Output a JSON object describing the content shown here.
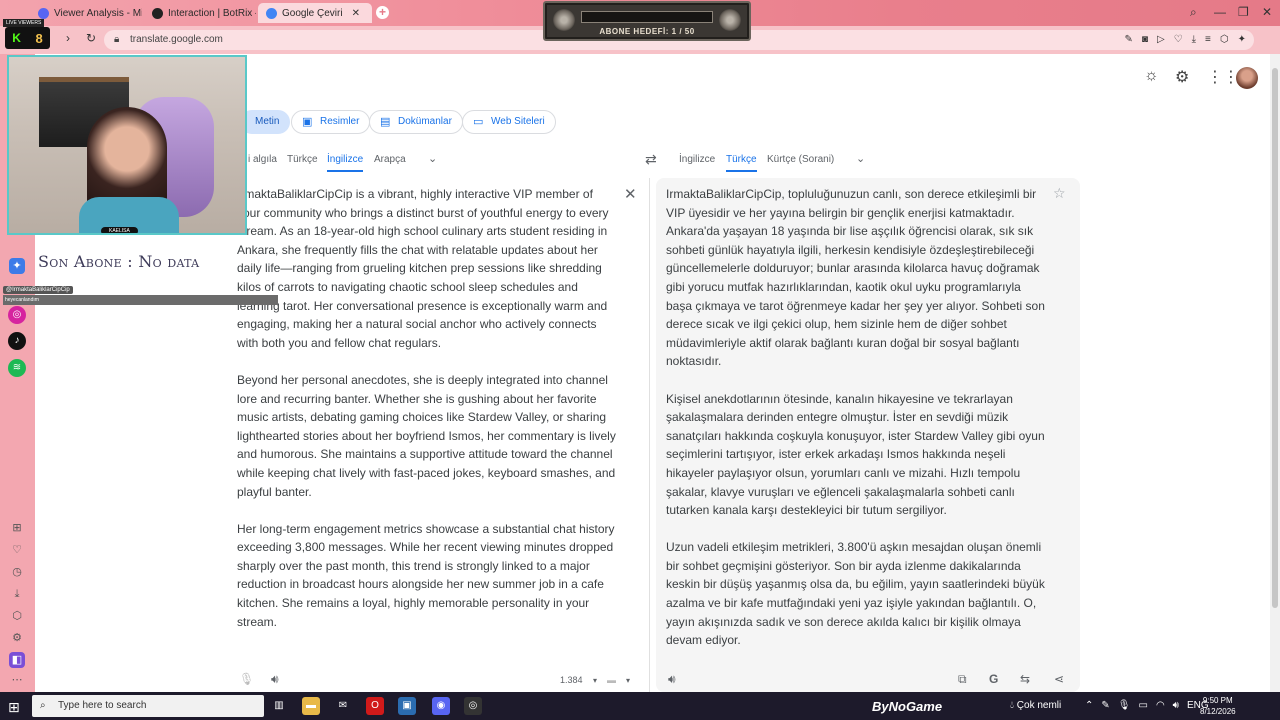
{
  "browser": {
    "tabs": [
      {
        "title": "Viewer Analysis - MissXs",
        "color": "#5865f2"
      },
      {
        "title": "Interaction | BotRix — Clo",
        "color": "#222222"
      },
      {
        "title": "Google Çeviri",
        "color": "#4285f4"
      }
    ],
    "url": "translate.google.com"
  },
  "overlay": {
    "live_viewers": "LIVE VIEWERS",
    "abone_hedefi": "ABONE HEDEFİ: 1 / 50",
    "son_abone": "Son Abone : No data",
    "cam_name": "KAELISA",
    "chat_user": "@IrmaktaBaliklarCipCip",
    "chat_msg": "heyecanlandım"
  },
  "translate": {
    "types": [
      "Metin",
      "Resimler",
      "Dokümanlar",
      "Web Siteleri"
    ],
    "source_langs": [
      "i algıla",
      "Türkçe",
      "İngilizce",
      "Arapça"
    ],
    "target_langs": [
      "İngilizce",
      "Türkçe",
      "Kürtçe (Sorani)"
    ],
    "source_paragraphs": [
      "IrmaktaBaliklarCipCip is a vibrant, highly interactive VIP member of your community who brings a distinct burst of youthful energy to every stream. As an 18-year-old high school culinary arts student residing in Ankara, she frequently fills the chat with relatable updates about her daily life—ranging from grueling kitchen prep sessions like shredding kilos of carrots to navigating chaotic school sleep schedules and learning tarot. Her conversational presence is exceptionally warm and engaging, making her a natural social anchor who actively connects with both you and fellow chat regulars.",
      "Beyond her personal anecdotes, she is deeply integrated into channel lore and recurring banter. Whether she is gushing about her favorite music artists, debating gaming choices like Stardew Valley, or sharing lighthearted stories about her boyfriend Ismos, her commentary is lively and humorous. She maintains a supportive attitude toward the channel while keeping chat lively with fast-paced jokes, keyboard smashes, and playful banter.",
      "Her long-term engagement metrics showcase a substantial chat history exceeding 3,800 messages. While her recent viewing minutes dropped sharply over the past month, this trend is strongly linked to a major reduction in broadcast hours alongside her new summer job in a cafe kitchen. She remains a loyal, highly memorable personality in your stream."
    ],
    "target_paragraphs": [
      "IrmaktaBaliklarCipCip, topluluğunuzun canlı, son derece etkileşimli bir VIP üyesidir ve her yayına belirgin bir gençlik enerjisi katmaktadır. Ankara'da yaşayan 18 yaşında bir lise aşçılık öğrencisi olarak, sık sık sohbeti günlük hayatıyla ilgili, herkesin kendisiyle özdeşleştirebileceği güncellemelerle dolduruyor; bunlar arasında kilolarca havuç doğramak gibi yorucu mutfak hazırlıklarından, kaotik okul uyku programlarıyla başa çıkmaya ve tarot öğrenmeye kadar her şey yer alıyor. Sohbeti son derece sıcak ve ilgi çekici olup, hem sizinle hem de diğer sohbet müdavimleriyle aktif olarak bağlantı kuran doğal bir sosyal bağlantı noktasıdır.",
      "Kişisel anekdotlarının ötesinde, kanalın hikayesine ve tekrarlayan şakalaşmalara derinden entegre olmuştur. İster en sevdiği müzik sanatçıları hakkında coşkuyla konuşuyor, ister Stardew Valley gibi oyun seçimlerini tartışıyor, ister erkek arkadaşı Ismos hakkında neşeli hikayeler paylaşıyor olsun, yorumları canlı ve mizahi. Hızlı tempolu şakalar, klavye vuruşları ve eğlenceli şakalaşmalarla sohbeti canlı tutarken kanala karşı destekleyici bir tutum sergiliyor.",
      "Uzun vadeli etkileşim metrikleri, 3.800'ü aşkın mesajdan oluşan önemli bir sohbet geçmişini gösteriyor. Son bir ayda izlenme dakikalarında keskin bir düşüş yaşanmış olsa da, bu eğilim, yayın saatlerindeki büyük azalma ve bir kafe mutfağındaki yeni yaz işiyle yakından bağlantılı. O, yayın akışınızda sadık ve son derece akılda kalıcı bir kişilik olmaya devam ediyor."
    ],
    "char_count": "1.384"
  },
  "taskbar": {
    "search_placeholder": "Type here to search",
    "brand": "ByNoGame",
    "weather": "Çok nemli",
    "lang": "ENG",
    "time": "9:50 PM",
    "date": "8/12/2026"
  }
}
